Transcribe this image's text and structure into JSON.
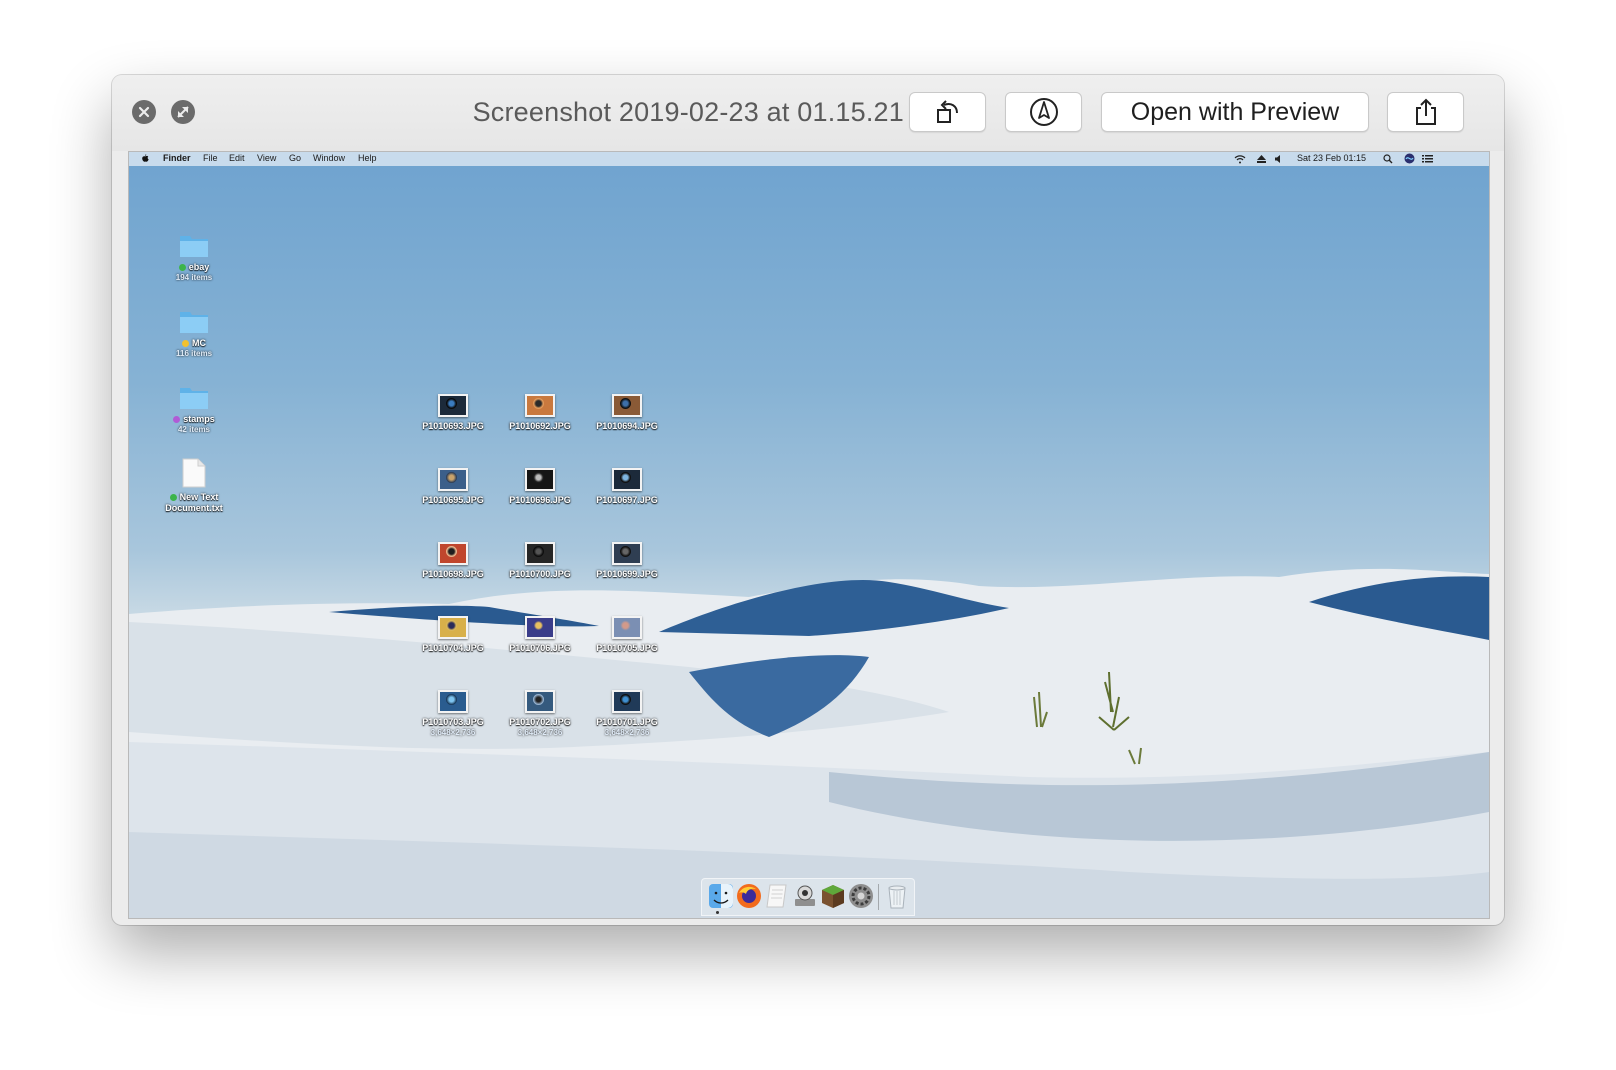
{
  "window": {
    "title": "Screenshot 2019-02-23 at 01.15.21",
    "toolbar": {
      "rotate_icon": "rotate-left-icon",
      "markup_icon": "markup-pen-icon",
      "open_label": "Open with Preview",
      "share_icon": "share-icon"
    }
  },
  "menubar": {
    "app": "Finder",
    "menus": [
      "File",
      "Edit",
      "View",
      "Go",
      "Window",
      "Help"
    ],
    "datetime": "Sat 23 Feb  01:15"
  },
  "desktop_items": [
    {
      "name": "ebay",
      "sub": "194 items",
      "tag": "#3cb44b"
    },
    {
      "name": "MC",
      "sub": "116 items",
      "tag": "#f2c12e"
    },
    {
      "name": "stamps",
      "sub": "42 items",
      "tag": "#b05bd6"
    },
    {
      "name": "New Text",
      "name2": "Document.txt",
      "tag": "#3cb44b"
    }
  ],
  "photos": [
    {
      "name": "P1010693.JPG"
    },
    {
      "name": "P1010692.JPG"
    },
    {
      "name": "P1010694.JPG"
    },
    {
      "name": "P1010695.JPG"
    },
    {
      "name": "P1010696.JPG"
    },
    {
      "name": "P1010697.JPG"
    },
    {
      "name": "P1010698.JPG"
    },
    {
      "name": "P1010700.JPG"
    },
    {
      "name": "P1010699.JPG"
    },
    {
      "name": "P1010704.JPG"
    },
    {
      "name": "P1010706.JPG"
    },
    {
      "name": "P1010705.JPG"
    },
    {
      "name": "P1010703.JPG",
      "dims": "3,648×2,736"
    },
    {
      "name": "P1010702.JPG",
      "dims": "3,648×2,736"
    },
    {
      "name": "P1010701.JPG",
      "dims": "3,648×2,736"
    }
  ],
  "dock": [
    "finder-icon",
    "firefox-icon",
    "textedit-icon",
    "utility-icon",
    "minecraft-icon",
    "system-preferences-icon",
    "trash-icon"
  ]
}
